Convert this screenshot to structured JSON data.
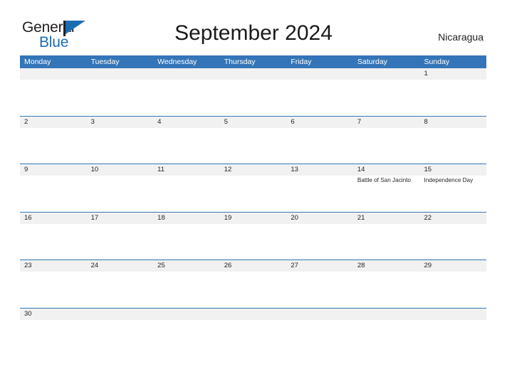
{
  "brand": {
    "name_part1": "General",
    "name_part2": "Blue"
  },
  "header": {
    "title": "September 2024",
    "country": "Nicaragua"
  },
  "calendar": {
    "weekday_headers": [
      "Monday",
      "Tuesday",
      "Wednesday",
      "Thursday",
      "Friday",
      "Saturday",
      "Sunday"
    ],
    "colors": {
      "header_blue": "#3375b8",
      "band_gray": "#f1f1f1",
      "rule_blue": "#3375b8",
      "text": "#231f20",
      "logo_blue": "#1c6cb3"
    },
    "weeks": [
      [
        {
          "date": "",
          "events": []
        },
        {
          "date": "",
          "events": []
        },
        {
          "date": "",
          "events": []
        },
        {
          "date": "",
          "events": []
        },
        {
          "date": "",
          "events": []
        },
        {
          "date": "",
          "events": []
        },
        {
          "date": "1",
          "events": []
        }
      ],
      [
        {
          "date": "2",
          "events": []
        },
        {
          "date": "3",
          "events": []
        },
        {
          "date": "4",
          "events": []
        },
        {
          "date": "5",
          "events": []
        },
        {
          "date": "6",
          "events": []
        },
        {
          "date": "7",
          "events": []
        },
        {
          "date": "8",
          "events": []
        }
      ],
      [
        {
          "date": "9",
          "events": []
        },
        {
          "date": "10",
          "events": []
        },
        {
          "date": "11",
          "events": []
        },
        {
          "date": "12",
          "events": []
        },
        {
          "date": "13",
          "events": []
        },
        {
          "date": "14",
          "events": [
            "Battle of San Jacinto"
          ]
        },
        {
          "date": "15",
          "events": [
            "Independence Day"
          ]
        }
      ],
      [
        {
          "date": "16",
          "events": []
        },
        {
          "date": "17",
          "events": []
        },
        {
          "date": "18",
          "events": []
        },
        {
          "date": "19",
          "events": []
        },
        {
          "date": "20",
          "events": []
        },
        {
          "date": "21",
          "events": []
        },
        {
          "date": "22",
          "events": []
        }
      ],
      [
        {
          "date": "23",
          "events": []
        },
        {
          "date": "24",
          "events": []
        },
        {
          "date": "25",
          "events": []
        },
        {
          "date": "26",
          "events": []
        },
        {
          "date": "27",
          "events": []
        },
        {
          "date": "28",
          "events": []
        },
        {
          "date": "29",
          "events": []
        }
      ],
      [
        {
          "date": "30",
          "events": []
        },
        {
          "date": "",
          "events": []
        },
        {
          "date": "",
          "events": []
        },
        {
          "date": "",
          "events": []
        },
        {
          "date": "",
          "events": []
        },
        {
          "date": "",
          "events": []
        },
        {
          "date": "",
          "events": []
        }
      ]
    ]
  }
}
